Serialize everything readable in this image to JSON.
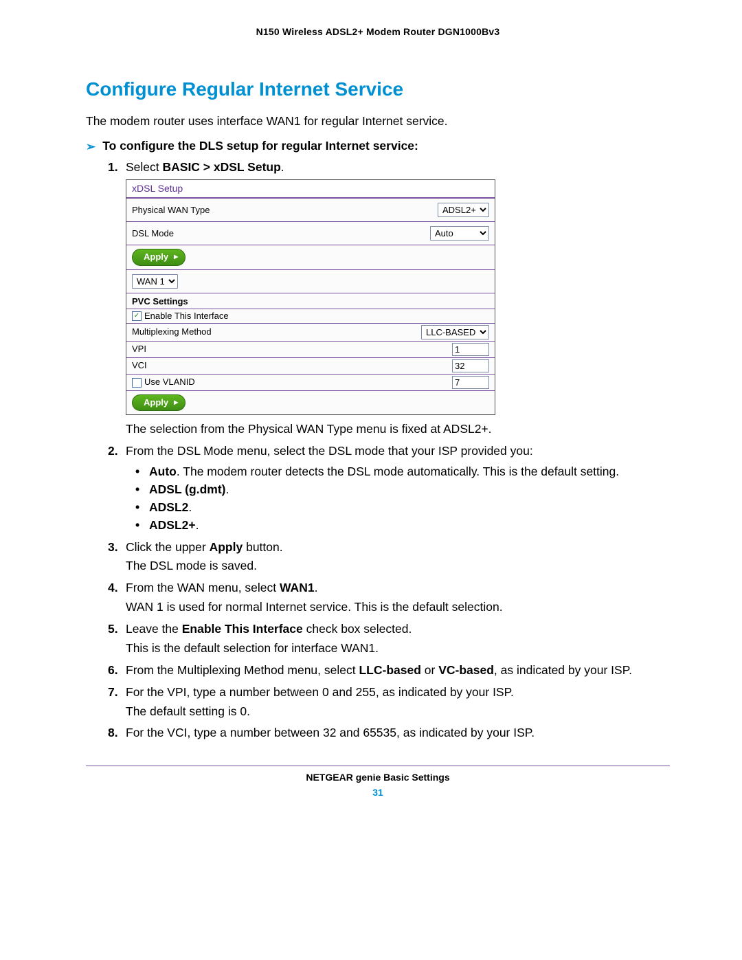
{
  "header": {
    "product_line": "N150 Wireless ADSL2+ Modem Router DGN1000Bv3"
  },
  "section": {
    "title": "Configure Regular Internet Service",
    "intro": "The modem router uses interface WAN1 for regular Internet service.",
    "procedure_lead": "To configure the DLS setup for regular Internet service:"
  },
  "ui": {
    "title": "xDSL Setup",
    "physical_wan_label": "Physical WAN Type",
    "physical_wan_value": "ADSL2+",
    "dsl_mode_label": "DSL Mode",
    "dsl_mode_value": "Auto",
    "apply_label": "Apply",
    "wan_value": "WAN 1",
    "pvc_head": "PVC Settings",
    "enable_iface_label": "Enable This Interface",
    "mux_label": "Multiplexing Method",
    "mux_value": "LLC-BASED",
    "vpi_label": "VPI",
    "vpi_value": "1",
    "vci_label": "VCI",
    "vci_value": "32",
    "vlan_label": "Use VLANID",
    "vlan_value": "7"
  },
  "steps": {
    "s1_lead_a": "Select ",
    "s1_lead_b": "BASIC > xDSL Setup",
    "s1_note": "The selection from the Physical WAN Type menu is fixed at ADSL2+.",
    "s2_lead": "From the DSL Mode menu, select the DSL mode that your ISP provided you:",
    "s2_b1_b": "Auto",
    "s2_b1_a": ". The modem router detects the DSL mode automatically. This is the default setting.",
    "s2_b2": "ADSL (g.dmt)",
    "s2_b3": "ADSL2",
    "s2_b4": "ADSL2+",
    "s3_a": "Click the upper ",
    "s3_b": "Apply",
    "s3_c": " button.",
    "s3_note": "The DSL mode is saved.",
    "s4_a": "From the WAN menu, select ",
    "s4_b": "WAN1",
    "s4_note": "WAN 1 is used for normal Internet service. This is the default selection.",
    "s5_a": "Leave the ",
    "s5_b": "Enable This Interface",
    "s5_c": " check box selected.",
    "s5_note": "This is the default selection for interface WAN1.",
    "s6_a": "From the Multiplexing Method menu, select ",
    "s6_b": "LLC-based",
    "s6_or": " or ",
    "s6_c": "VC-based",
    "s6_d": ", as indicated by your ISP.",
    "s7_a": "For the VPI, type a number between 0 and 255, as indicated by your ISP.",
    "s7_note": "The default setting is 0.",
    "s8_a": "For the VCI, type a number between 32 and 65535, as indicated by your ISP."
  },
  "footer": {
    "chapter": "NETGEAR genie Basic Settings",
    "page": "31"
  }
}
